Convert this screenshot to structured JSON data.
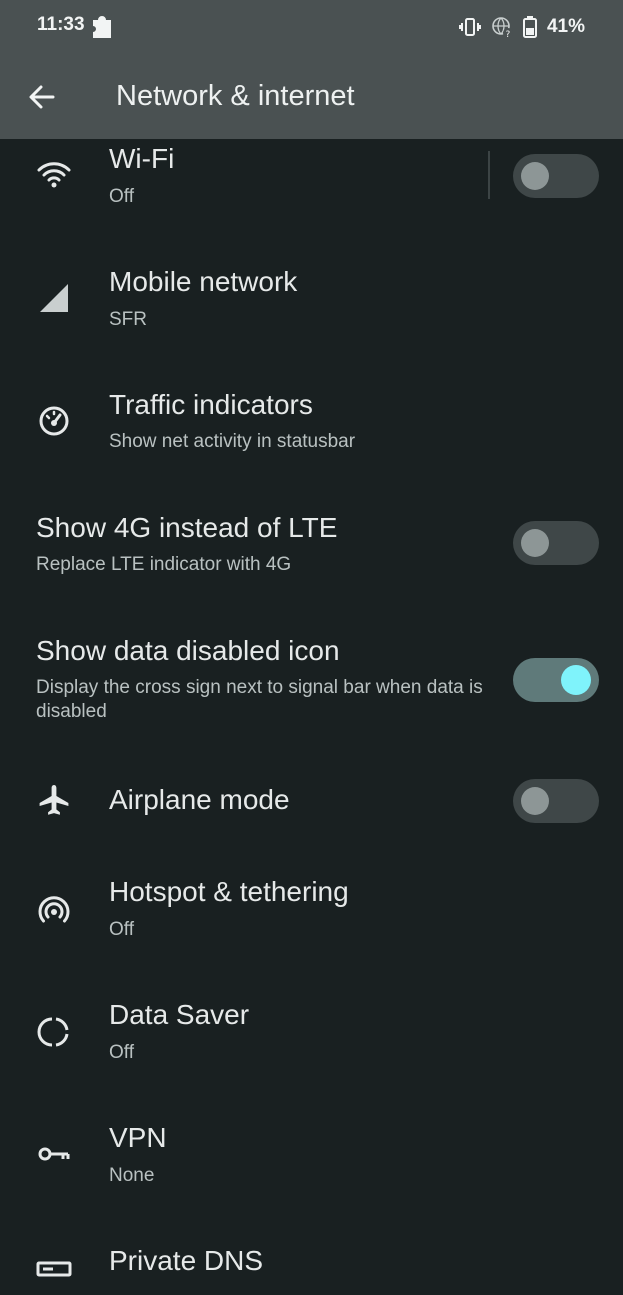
{
  "status_bar": {
    "time": "11:33",
    "battery": "41%"
  },
  "app_bar": {
    "title": "Network & internet"
  },
  "items": [
    {
      "title": "Wi-Fi",
      "subtitle": "Off",
      "toggle": false
    },
    {
      "title": "Mobile network",
      "subtitle": "SFR"
    },
    {
      "title": "Traffic indicators",
      "subtitle": "Show net activity in statusbar"
    },
    {
      "title": "Show 4G instead of LTE",
      "subtitle": "Replace LTE indicator with 4G",
      "toggle": false
    },
    {
      "title": "Show data disabled icon",
      "subtitle": "Display the cross sign next to signal bar when data is disabled",
      "toggle": true
    },
    {
      "title": "Airplane mode",
      "toggle": false
    },
    {
      "title": "Hotspot & tethering",
      "subtitle": "Off"
    },
    {
      "title": "Data Saver",
      "subtitle": "Off"
    },
    {
      "title": "VPN",
      "subtitle": "None"
    },
    {
      "title": "Private DNS"
    }
  ],
  "icons": {
    "notification": "puzzle-icon",
    "vibrate": "vibrate-icon",
    "no-internet": "globe-question-icon",
    "battery": "battery-icon",
    "back": "arrow-back-icon",
    "wifi": "wifi-icon",
    "mobile": "signal-icon",
    "traffic": "speedometer-icon",
    "airplane": "airplane-icon",
    "hotspot": "hotspot-icon",
    "datasaver": "data-saver-icon",
    "vpn": "key-icon",
    "dns": "dns-icon"
  },
  "colors": {
    "accent": "#7ff3fb",
    "background": "#192021",
    "header": "#4a5152"
  }
}
